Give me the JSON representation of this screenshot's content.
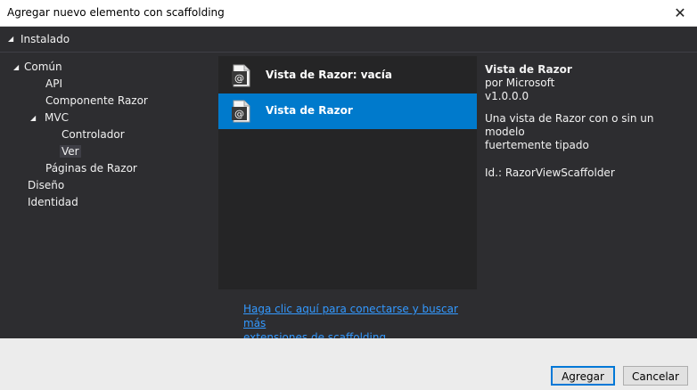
{
  "window": {
    "title": "Agregar nuevo elemento con scaffolding",
    "close_glyph": "✕"
  },
  "installed": {
    "label": "Instalado"
  },
  "tree": [
    {
      "label": "Común",
      "expanded": true
    },
    {
      "label": "API"
    },
    {
      "label": "Componente Razor"
    },
    {
      "label": "MVC",
      "expanded": true
    },
    {
      "label": "Controlador"
    },
    {
      "label": "Ver",
      "selected": true
    },
    {
      "label": "Páginas de Razor"
    },
    {
      "label": "Diseño"
    },
    {
      "label": "Identidad"
    }
  ],
  "templates": [
    {
      "label": "Vista de Razor: vacía",
      "icon": "razor-file-icon"
    },
    {
      "label": "Vista de Razor",
      "icon": "razor-file-icon",
      "selected": true
    }
  ],
  "more_link": {
    "line1": "Haga clic aquí para conectarse y buscar más",
    "line2": "extensiones de scaffolding."
  },
  "details": {
    "name": "Vista de Razor",
    "publisher": "por Microsoft",
    "version": "v1.0.0.0",
    "description_line1": "Una vista de Razor con o sin un modelo",
    "description_line2": "fuertemente tipado",
    "id": "Id.: RazorViewScaffolder"
  },
  "buttons": {
    "add": "Agregar",
    "cancel": "Cancelar"
  },
  "colors": {
    "background": "#2d2d30",
    "list_background": "#252526",
    "selection": "#007acc",
    "link": "#3399ff"
  }
}
